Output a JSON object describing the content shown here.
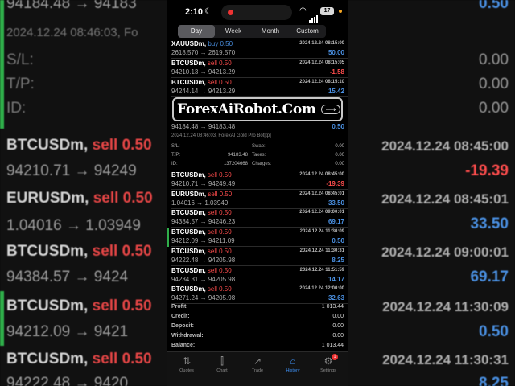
{
  "status": {
    "time": "2:10",
    "battery": "17"
  },
  "tabs_top": [
    "Day",
    "Week",
    "Month",
    "Custom"
  ],
  "trades_top": [
    {
      "symbol": "XAUUSDm,",
      "side": "buy 0.50",
      "side_type": "buy",
      "date": "2024.12.24 08:15:00",
      "prices": "2618.570 → 2619.570",
      "profit": "50.00",
      "profit_type": "pos"
    },
    {
      "symbol": "BTCUSDm,",
      "side": "sell 0.50",
      "side_type": "sell",
      "date": "2024.12.24 08:15:05",
      "prices": "94210.13 → 94213.29",
      "profit": "-1.58",
      "profit_type": "neg"
    },
    {
      "symbol": "BTCUSDm,",
      "side": "sell 0.50",
      "side_type": "sell",
      "date": "2024.12.24 08:15:10",
      "prices": "94244.14 → 94213.29",
      "profit": "15.42",
      "profit_type": "pos"
    }
  ],
  "banner": {
    "text": "ForexAiRobot.Com"
  },
  "expanded": {
    "prices": "94184.48 → 94183.48",
    "profit": "0.50",
    "header": "2024.12.24 08:46:03, ForexAI Gold Pro Bot[tp]",
    "sl_label": "S/L:",
    "sl_value": "-",
    "tp_label": "T/P:",
    "tp_value": "94183.48",
    "id_label": "ID:",
    "id_value": "137204668",
    "swap_label": "Swap:",
    "swap_value": "0.00",
    "taxes_label": "Taxes:",
    "taxes_value": "0.00",
    "charges_label": "Charges:",
    "charges_value": "0.00"
  },
  "trades_bottom": [
    {
      "symbol": "BTCUSDm,",
      "side": "sell 0.50",
      "side_type": "sell",
      "date": "2024.12.24 08:45:00",
      "prices": "94210.71 → 94249.49",
      "profit": "-19.39",
      "profit_type": "neg",
      "hl": false
    },
    {
      "symbol": "EURUSDm,",
      "side": "sell 0.50",
      "side_type": "sell",
      "date": "2024.12.24 08:45:01",
      "prices": "1.04016 → 1.03949",
      "profit": "33.50",
      "profit_type": "pos",
      "hl": false
    },
    {
      "symbol": "BTCUSDm,",
      "side": "sell 0.50",
      "side_type": "sell",
      "date": "2024.12.24 09:00:01",
      "prices": "94384.57 → 94246.23",
      "profit": "69.17",
      "profit_type": "pos",
      "hl": false
    },
    {
      "symbol": "BTCUSDm,",
      "side": "sell 0.50",
      "side_type": "sell",
      "date": "2024.12.24 11:30:09",
      "prices": "94212.09 → 94211.09",
      "profit": "0.50",
      "profit_type": "pos",
      "hl": true
    },
    {
      "symbol": "BTCUSDm,",
      "side": "sell 0.50",
      "side_type": "sell",
      "date": "2024.12.24 11:30:31",
      "prices": "94222.48 → 94205.98",
      "profit": "8.25",
      "profit_type": "pos",
      "hl": false
    },
    {
      "symbol": "BTCUSDm,",
      "side": "sell 0.50",
      "side_type": "sell",
      "date": "2024.12.24 11:51:59",
      "prices": "94234.31 → 94205.98",
      "profit": "14.17",
      "profit_type": "pos",
      "hl": false
    },
    {
      "symbol": "BTCUSDm,",
      "side": "sell 0.50",
      "side_type": "sell",
      "date": "2024.12.24 12:00:00",
      "prices": "94271.24 → 94205.98",
      "profit": "32.63",
      "profit_type": "pos",
      "hl": false
    }
  ],
  "summary": [
    {
      "label": "Profit:",
      "value": "1 013.44"
    },
    {
      "label": "Credit:",
      "value": "0.00"
    },
    {
      "label": "Deposit:",
      "value": "0.00"
    },
    {
      "label": "Withdrawal:",
      "value": "0.00"
    },
    {
      "label": "Balance:",
      "value": "1 013.44"
    }
  ],
  "tabbar": [
    {
      "label": "Quotes",
      "icon": "quotes-icon",
      "glyph": "⇅"
    },
    {
      "label": "Chart",
      "icon": "chart-icon",
      "glyph": "⫿"
    },
    {
      "label": "Trade",
      "icon": "trade-icon",
      "glyph": "↗"
    },
    {
      "label": "History",
      "icon": "history-icon",
      "glyph": "⌂"
    },
    {
      "label": "Settings",
      "icon": "settings-icon",
      "glyph": "⚙"
    }
  ],
  "settings_badge": "1",
  "bg": {
    "top_price": "94184.48 → 94183",
    "top_profit": "0.50",
    "header": "2024.12.24 08:46:03, Fo",
    "sl": "S/L:",
    "tp": "T/P:",
    "id": "ID:",
    "sl_v": "0.00",
    "tp_v": "0.00",
    "id_v": "0.00",
    "r1_sym": "BTCUSDm,",
    "r1_side": "sell 0.50",
    "r1_date": "2024.12.24 08:45:00",
    "r1_price": "94210.71 → 94249",
    "r1_profit": "-19.39",
    "r2_sym": "EURUSDm,",
    "r2_side": "sell 0.50",
    "r2_date": "2024.12.24 08:45:01",
    "r2_price": "1.04016 → 1.03949",
    "r2_profit": "33.50",
    "r3_sym": "BTCUSDm,",
    "r3_side": "sell 0.50",
    "r3_date": "2024.12.24 09:00:01",
    "r3_price": "94384.57 → 9424",
    "r3_profit": "69.17",
    "r4_sym": "BTCUSDm,",
    "r4_side": "sell 0.50",
    "r4_date": "2024.12.24 11:30:09",
    "r4_price": "94212.09 → 9421",
    "r4_profit": "0.50",
    "r5_sym": "BTCUSDm,",
    "r5_side": "sell 0.50",
    "r5_date": "2024.12.24 11:30:31",
    "r5_price": "94222.48 → 9420",
    "r5_profit": "8.25"
  }
}
